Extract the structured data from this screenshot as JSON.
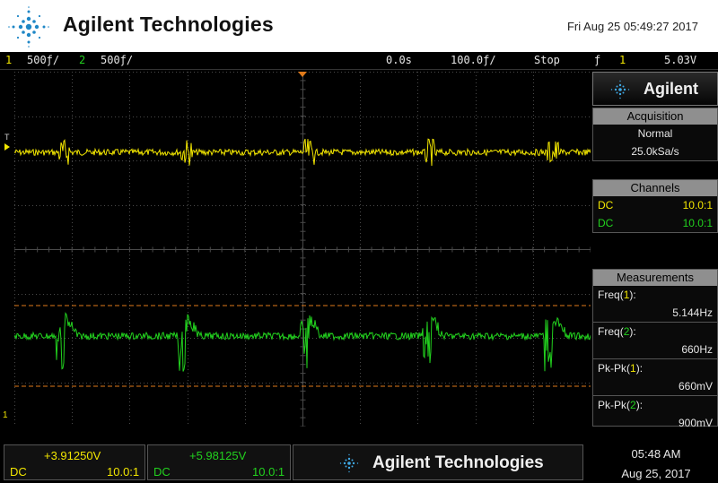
{
  "banner": {
    "brand": "Agilent Technologies",
    "datetime": "Fri Aug 25 05:49:27 2017"
  },
  "status": {
    "ch1_num": "1",
    "ch1_scale": "500ƒ/",
    "ch2_num": "2",
    "ch2_scale": "500ƒ/",
    "delay": "0.0s",
    "timebase": "100.0ƒ/",
    "run_state": "Stop",
    "trigger_icon": "ƒ",
    "trigger_src": "1",
    "trigger_level": "5.03V"
  },
  "panel": {
    "brand": "Agilent",
    "acquisition": {
      "title": "Acquisition",
      "mode": "Normal",
      "rate": "25.0kSa/s"
    },
    "channels": {
      "title": "Channels",
      "rows": [
        {
          "coupling": "DC",
          "probe": "10.0:1"
        },
        {
          "coupling": "DC",
          "probe": "10.0:1"
        }
      ]
    },
    "measurements": {
      "title": "Measurements",
      "items": [
        {
          "label": "Freq",
          "ch": "1",
          "value": "5.144Hz"
        },
        {
          "label": "Freq",
          "ch": "2",
          "value": "660Hz"
        },
        {
          "label": "Pk-Pk",
          "ch": "1",
          "value": "660mV"
        },
        {
          "label": "Pk-Pk",
          "ch": "2",
          "value": "900mV"
        }
      ]
    }
  },
  "markers": {
    "trigger_marker": "T",
    "ch_marker": "1"
  },
  "bottom": {
    "ch1_offset": "+3.91250V",
    "ch1_coupling": "DC",
    "ch1_probe": "10.0:1",
    "ch2_offset": "+5.98125V",
    "ch2_coupling": "DC",
    "ch2_probe": "10.0:1",
    "brand": "Agilent Technologies",
    "time": "05:48 AM",
    "date": "Aug 25, 2017"
  },
  "colors": {
    "ch1": "#f2e600",
    "ch2": "#22d11e",
    "cursor": "#e07a1a",
    "grid": "#4a4a4a"
  }
}
